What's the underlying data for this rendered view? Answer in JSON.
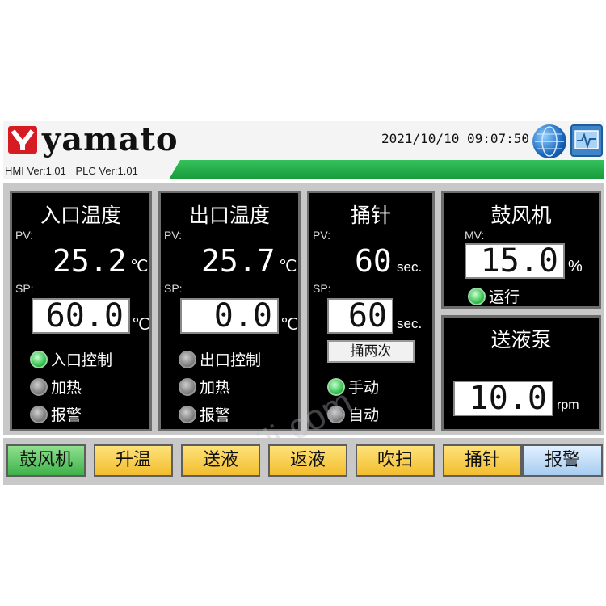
{
  "header": {
    "brand": "yamato",
    "datetime": "2021/10/10 09:07:50",
    "hmi_version": "HMI Ver:1.01",
    "plc_version": "PLC Ver:1.01",
    "icons": [
      "globe-icon",
      "monitor-icon"
    ],
    "colors": {
      "brand_red": "#d61b23",
      "strip_green": "#22aa48"
    }
  },
  "inlet": {
    "title": "入口温度",
    "pv_label": "PV:",
    "pv": "25.2",
    "unit": "℃",
    "sp_label": "SP:",
    "sp": "60.0",
    "indicators": [
      {
        "label": "入口控制",
        "on": true
      },
      {
        "label": "加热",
        "on": false
      },
      {
        "label": "报警",
        "on": false
      }
    ]
  },
  "outlet": {
    "title": "出口温度",
    "pv_label": "PV:",
    "pv": "25.7",
    "unit": "℃",
    "sp_label": "SP:",
    "sp": "0.0",
    "indicators": [
      {
        "label": "出口控制",
        "on": false
      },
      {
        "label": "加热",
        "on": false
      },
      {
        "label": "报警",
        "on": false
      }
    ]
  },
  "needle": {
    "title": "捅针",
    "pv_label": "PV:",
    "pv": "60",
    "unit": "sec.",
    "sp_label": "SP:",
    "sp": "60",
    "button": "捅两次",
    "indicators": [
      {
        "label": "手动",
        "on": true
      },
      {
        "label": "自动",
        "on": false
      }
    ]
  },
  "blower": {
    "title": "鼓风机",
    "mv_label": "MV:",
    "mv": "15.0",
    "unit": "%",
    "indicator": {
      "label": "运行",
      "on": true
    }
  },
  "pump": {
    "title": "送液泵",
    "value": "10.0",
    "unit": "rpm"
  },
  "buttons": [
    {
      "label": "鼓风机",
      "color": "#4cbb55"
    },
    {
      "label": "升温",
      "color": "#f6c843"
    },
    {
      "label": "送液",
      "color": "#f6c843"
    },
    {
      "label": "返液",
      "color": "#f6c843"
    },
    {
      "label": "吹扫",
      "color": "#f6c843"
    },
    {
      "label": "捅针",
      "color": "#f6c843"
    },
    {
      "label": "报警",
      "color": "#b9d9f5"
    }
  ],
  "watermark": "vyiji.com"
}
